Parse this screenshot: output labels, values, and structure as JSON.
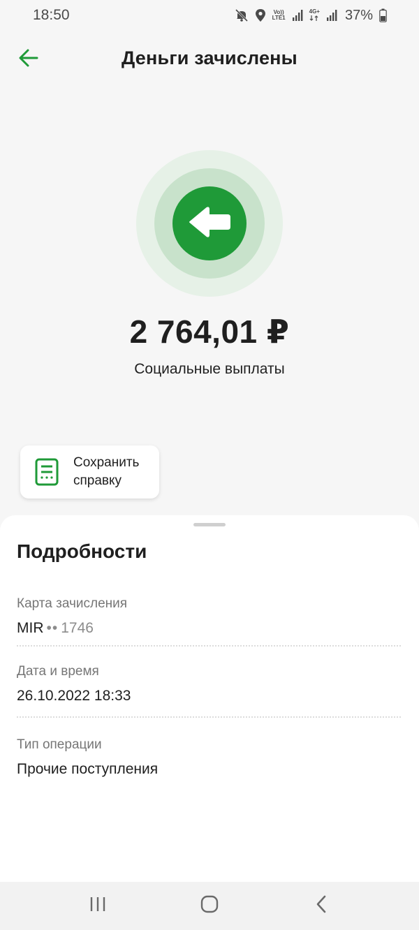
{
  "status_bar": {
    "time": "18:50",
    "volte_label_top": "Vo))",
    "volte_label_bottom": "LTE1",
    "network_label": "4G+",
    "battery_percent": "37%",
    "icons": [
      "mute-icon",
      "location-icon",
      "signal-icon",
      "battery-icon"
    ]
  },
  "header": {
    "title": "Деньги зачислены",
    "back_icon": "arrow-left-icon"
  },
  "hero": {
    "icon": "incoming-arrow-icon",
    "amount": "2 764,01 ₽",
    "subtitle": "Социальные выплаты"
  },
  "actions": {
    "save_icon": "document-icon",
    "save_label": "Сохранить справку"
  },
  "details": {
    "title": "Подробности",
    "items": [
      {
        "label": "Карта зачисления",
        "value_prefix": "MIR",
        "value_dots": "••",
        "value_suffix": "1746"
      },
      {
        "label": "Дата и время",
        "value": "26.10.2022 18:33"
      },
      {
        "label": "Тип операции",
        "value": "Прочие поступления"
      }
    ]
  },
  "nav_bar": {
    "buttons": [
      "recent-apps-icon",
      "home-icon",
      "back-icon"
    ]
  },
  "colors": {
    "accent": "#1f9a38",
    "ring_outer": "#e6f1e7",
    "ring_inner": "#c8e2cb",
    "background": "#f6f6f6",
    "text_primary": "#1f1f1f",
    "text_secondary": "#767676"
  }
}
